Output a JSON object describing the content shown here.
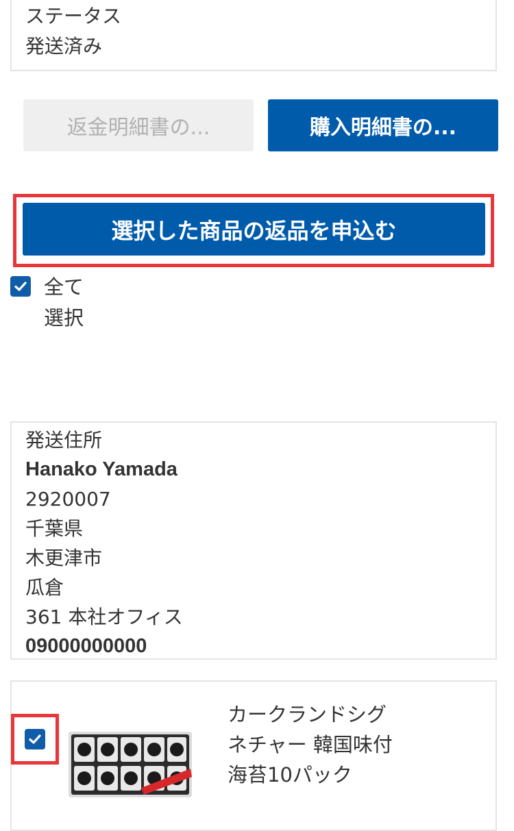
{
  "status": {
    "label": "ステータス",
    "value": "発送済み"
  },
  "actions": {
    "refund_statement": "返金明細書の...",
    "purchase_statement": "購入明細書の...",
    "return_request": "選択した商品の返品を申込む"
  },
  "select_all": {
    "line1": "全て",
    "line2": "選択",
    "checked": true
  },
  "address": {
    "label": "発送住所",
    "name": "Hanako Yamada",
    "postal": "2920007",
    "prefecture": "千葉県",
    "city": "木更津市",
    "town": "瓜倉",
    "street": "361 本社オフィス",
    "phone": "09000000000"
  },
  "item": {
    "checked": true,
    "name_line1": "カークランドシグ",
    "name_line2": "ネチャー 韓国味付",
    "name_line3": "海苔10パック",
    "image": "seaweed-package-image"
  },
  "colors": {
    "primary": "#005bab",
    "highlight": "#e8363a",
    "disabled_bg": "#efefef",
    "disabled_text": "#b1b1b1",
    "border": "#e4e4e4"
  }
}
